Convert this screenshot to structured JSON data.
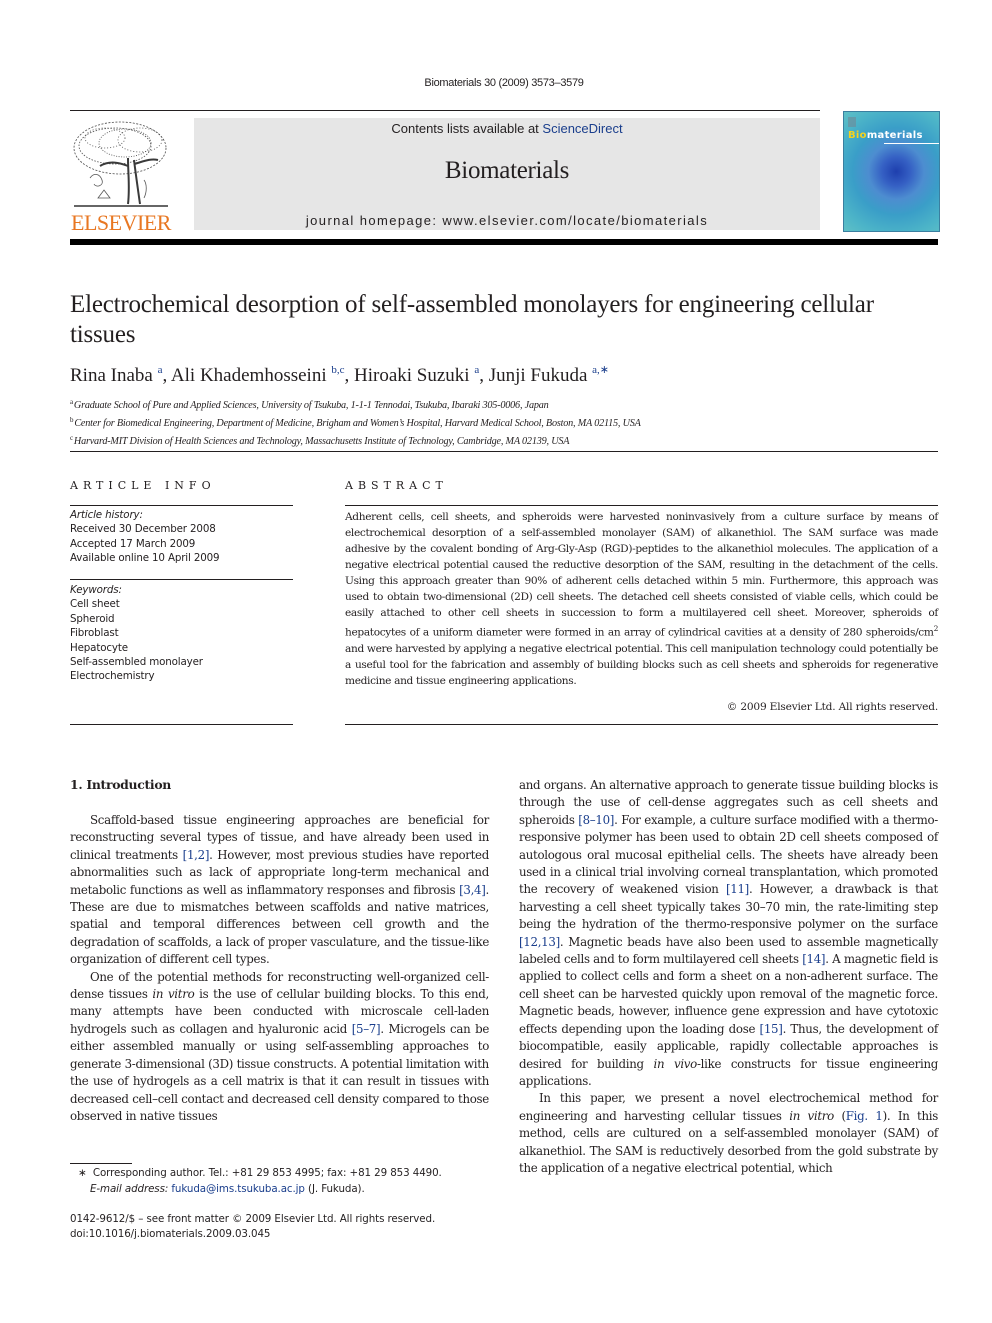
{
  "header": {
    "citation": "Biomaterials 30 (2009) 3573–3579",
    "contents_prefix": "Contents lists available at ",
    "contents_link": "ScienceDirect",
    "journal_name": "Biomaterials",
    "homepage_prefix": "journal homepage: ",
    "homepage_url": "www.elsevier.com/locate/biomaterials",
    "publisher_logo_text": "ELSEVIER",
    "cover_title_first": "Bio",
    "cover_title_rest": "materials"
  },
  "article": {
    "title": "Electrochemical desorption of self-assembled monolayers for engineering cellular tissues",
    "authors": [
      {
        "name": "Rina Inaba",
        "sup": "a"
      },
      {
        "name": "Ali Khademhosseini",
        "sup": "b,c"
      },
      {
        "name": "Hiroaki Suzuki",
        "sup": "a"
      },
      {
        "name": "Junji Fukuda",
        "sup": "a,∗"
      }
    ],
    "affiliations": [
      {
        "key": "a",
        "text": "Graduate School of Pure and Applied Sciences, University of Tsukuba, 1-1-1 Tennodai, Tsukuba, Ibaraki 305-0006, Japan"
      },
      {
        "key": "b",
        "text": "Center for Biomedical Engineering, Department of Medicine, Brigham and Women’s Hospital, Harvard Medical School, Boston, MA 02115, USA"
      },
      {
        "key": "c",
        "text": "Harvard-MIT Division of Health Sciences and Technology, Massachusetts Institute of Technology, Cambridge, MA 02139, USA"
      }
    ]
  },
  "article_info": {
    "heading": "ARTICLE INFO",
    "history_label": "Article history:",
    "history": [
      "Received 30 December 2008",
      "Accepted 17 March 2009",
      "Available online 10 April 2009"
    ],
    "keywords_label": "Keywords:",
    "keywords": [
      "Cell sheet",
      "Spheroid",
      "Fibroblast",
      "Hepatocyte",
      "Self-assembled monolayer",
      "Electrochemistry"
    ]
  },
  "abstract": {
    "heading": "ABSTRACT",
    "text_before_sup": "Adherent cells, cell sheets, and spheroids were harvested noninvasively from a culture surface by means of electrochemical desorption of a self-assembled monolayer (SAM) of alkanethiol. The SAM surface was made adhesive by the covalent bonding of Arg-Gly-Asp (RGD)-peptides to the alkanethiol molecules. The application of a negative electrical potential caused the reductive desorption of the SAM, resulting in the detachment of the cells. Using this approach greater than 90% of adherent cells detached within 5 min. Furthermore, this approach was used to obtain two-dimensional (2D) cell sheets. The detached cell sheets consisted of viable cells, which could be easily attached to other cell sheets in succession to form a multilayered cell sheet. Moreover, spheroids of hepatocytes of a uniform diameter were formed in an array of cylindrical cavities at a density of 280 spheroids/cm",
    "sup": "2",
    "text_after_sup": " and were harvested by applying a negative electrical potential. This cell manipulation technology could potentially be a useful tool for the fabri­cation and assembly of building blocks such as cell sheets and spheroids for regenerative medicine and tissue engineering applications.",
    "copyright": "© 2009 Elsevier Ltd. All rights reserved."
  },
  "body": {
    "section_heading": "1.  Introduction",
    "p1": [
      {
        "t": "Scaffold-based tissue engineering approaches are beneficial for reconstructing several types of tissue, and have already been used in clinical treatments "
      },
      {
        "t": "[1,2]",
        "link": true
      },
      {
        "t": ". However, most previous studies have reported abnormalities such as lack of appropriate long-term mechanical and metabolic functions as well as inflammatory responses and fibrosis "
      },
      {
        "t": "[3,4]",
        "link": true
      },
      {
        "t": ". These are due to mismatches between scaffolds and native matrices, spatial and temporal differences between cell growth and the degradation of scaffolds, a lack of proper vasculature, and the tissue-like organization of different cell types."
      }
    ],
    "p2": [
      {
        "t": "One of the potential methods for reconstructing well-organized cell-dense tissues "
      },
      {
        "t": "in vitro",
        "it": true
      },
      {
        "t": " is the use of cellular building blocks. To this end, many attempts have been conducted with microscale cell-laden hydrogels such as collagen and hyaluronic acid "
      },
      {
        "t": "[5–7]",
        "link": true
      },
      {
        "t": ". Microgels can be either assembled manually or using self-assem­bling approaches to generate 3-dimensional (3D) tissue constructs. A potential limitation with the use of hydrogels as a cell matrix is that it can result in tissues with decreased cell–cell contact and decreased cell density compared to those observed in native tissues and organs. An alternative approach to generate tissue building blocks is through the use of cell-dense aggregates such as cell sheets and spheroids "
      },
      {
        "t": "[8–10]",
        "link": true
      },
      {
        "t": ". For example, a culture surface modi­fied with a thermo-responsive polymer has been used to obtain 2D cell sheets composed of autologous oral mucosal epithelial cells. The sheets have already been used in a clinical trial involving corneal transplantation, which promoted the recovery of weakened vision "
      },
      {
        "t": "[11]",
        "link": true
      },
      {
        "t": ". However, a drawback is that harvesting a cell sheet typically takes 30–70 min, the rate-limiting step being the hydra­tion of the thermo-responsive polymer on the surface "
      },
      {
        "t": "[12,13]",
        "link": true
      },
      {
        "t": ". Magnetic beads have also been used to assemble magnetically labeled cells and to form multilayered cell sheets "
      },
      {
        "t": "[14]",
        "link": true
      },
      {
        "t": ". A magnetic field is applied to collect cells and form a sheet on a non-adherent surface. The cell sheet can be harvested quickly upon removal of the magnetic force. Magnetic beads, however, influence gene expres­sion and have cytotoxic effects depending upon the loading dose "
      },
      {
        "t": "[15]",
        "link": true
      },
      {
        "t": ". Thus, the development of biocompatible, easily applicable, rapidly collectable approaches is desired for building "
      },
      {
        "t": "in vivo",
        "it": true
      },
      {
        "t": "-like constructs for tissue engineering applications."
      }
    ],
    "p3": [
      {
        "t": "In this paper, we present a novel electrochemical method for engineering and harvesting cellular tissues "
      },
      {
        "t": "in vitro",
        "it": true
      },
      {
        "t": " ("
      },
      {
        "t": "Fig. 1",
        "link": true
      },
      {
        "t": "). In this method, cells are cultured on a self-assembled monolayer (SAM) of alkanethiol. The SAM is reductively desorbed from the gold substrate by the application of a negative electrical potential, which"
      }
    ],
    "left_p2_split": "One of the potential methods for reconstructing well-organized cell-dense tissues ",
    "left_column_p2": [
      {
        "t": "One of the potential methods for reconstructing well-organized cell-dense tissues "
      },
      {
        "t": "in vitro",
        "it": true
      },
      {
        "t": " is the use of cellular building blocks. To this end, many attempts have been conducted with microscale cell-laden hydrogels such as collagen and hyaluronic acid "
      },
      {
        "t": "[5–7]",
        "link": true
      },
      {
        "t": ". Microgels can be either assembled manually or using self-assem­bling approaches to generate 3-dimensional (3D) tissue constructs. A potential limitation with the use of hydrogels as a cell matrix is that it can result in tissues with decreased cell–cell contact and decreased cell density compared to those observed in native tissues"
      }
    ],
    "right_column_p2_cont": [
      {
        "t": "and organs. An alternative approach to generate tissue building blocks is through the use of cell-dense aggregates such as cell sheets and spheroids "
      },
      {
        "t": "[8–10]",
        "link": true
      },
      {
        "t": ". For example, a culture surface modi­fied with a thermo-responsive polymer has been used to obtain 2D cell sheets composed of autologous oral mucosal epithelial cells. The sheets have already been used in a clinical trial involving corneal transplantation, which promoted the recovery of weakened vision "
      },
      {
        "t": "[11]",
        "link": true
      },
      {
        "t": ". However, a drawback is that harvesting a cell sheet typically takes 30–70 min, the rate-limiting step being the hydra­tion of the thermo-responsive polymer on the surface "
      },
      {
        "t": "[12,13]",
        "link": true
      },
      {
        "t": ". Magnetic beads have also been used to assemble magnetically labeled cells and to form multilayered cell sheets "
      },
      {
        "t": "[14]",
        "link": true
      },
      {
        "t": ". A magnetic field is applied to collect cells and form a sheet on a non-adherent surface. The cell sheet can be harvested quickly upon removal of the magnetic force. Magnetic beads, however, influence gene expres­sion and have cytotoxic effects depending upon the loading dose "
      },
      {
        "t": "[15]",
        "link": true
      },
      {
        "t": ". Thus, the development of biocompatible, easily applicable, rapidly collectable approaches is desired for building "
      },
      {
        "t": "in vivo",
        "it": true
      },
      {
        "t": "-like constructs for tissue engineering applications."
      }
    ]
  },
  "footnote": {
    "marker": "∗",
    "line1": "Corresponding author. Tel.: +81 29 853 4995; fax: +81 29 853 4490.",
    "email_label": "E-mail address: ",
    "email": "fukuda@ims.tsukuba.ac.jp",
    "email_suffix": " (J. Fukuda)."
  },
  "front_matter": {
    "line1": "0142-9612/$ – see front matter © 2009 Elsevier Ltd. All rights reserved.",
    "doi": "doi:10.1016/j.biomaterials.2009.03.045"
  },
  "colors": {
    "link": "#1a3e8c",
    "elsevier_orange": "#e87722",
    "banner_gray": "#e6e6e6",
    "text": "#231f20"
  }
}
